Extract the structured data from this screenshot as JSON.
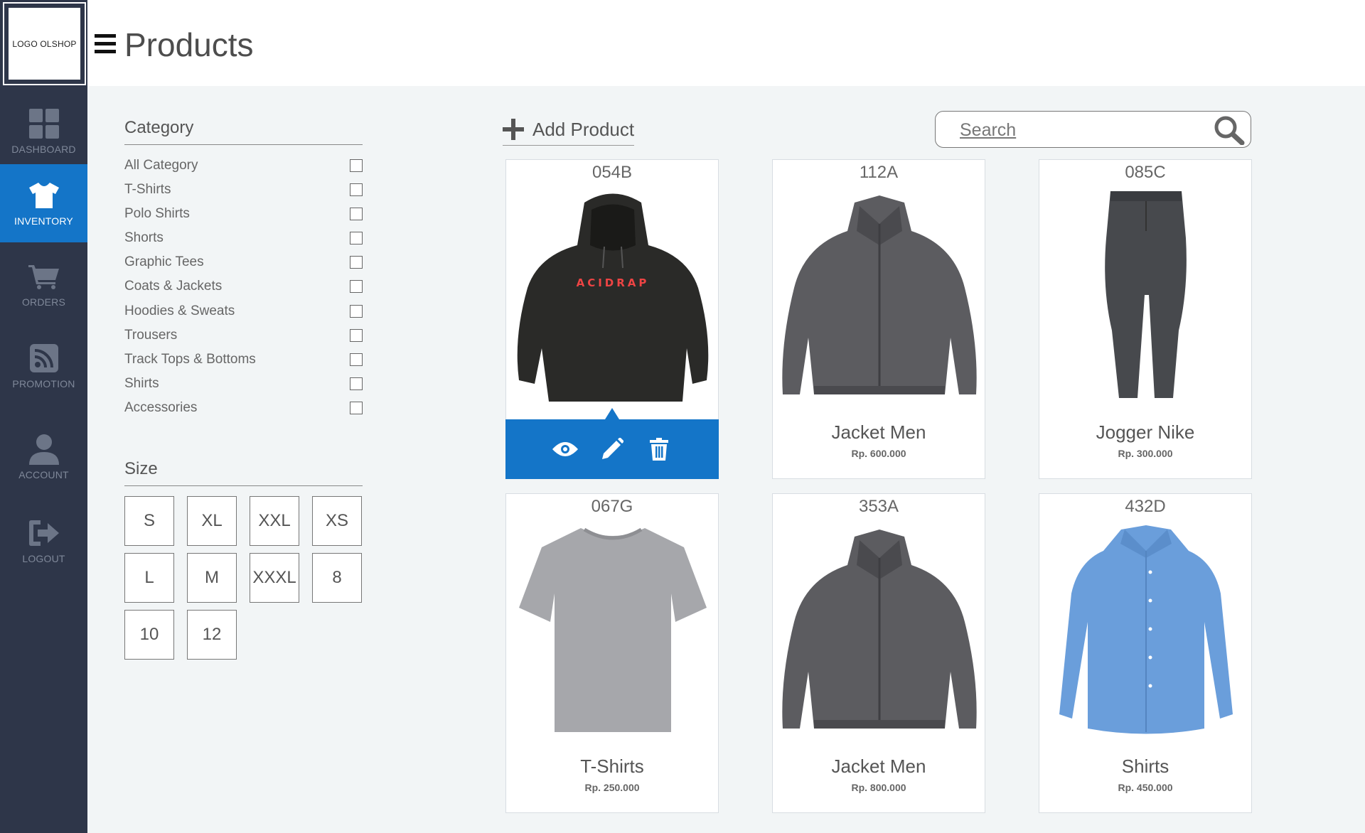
{
  "logo": {
    "text": "LOGO OLSHOP"
  },
  "header": {
    "title": "Products",
    "menu_icon": "hamburger-icon"
  },
  "sidebar": {
    "items": [
      {
        "label": "DASHBOARD",
        "icon": "grid-icon",
        "active": false
      },
      {
        "label": "INVENTORY",
        "icon": "tshirt-icon",
        "active": true
      },
      {
        "label": "ORDERS",
        "icon": "cart-icon",
        "active": false
      },
      {
        "label": "PROMOTION",
        "icon": "rss-icon",
        "active": false
      },
      {
        "label": "ACCOUNT",
        "icon": "user-icon",
        "active": false
      },
      {
        "label": "LOGOUT",
        "icon": "logout-icon",
        "active": false
      }
    ]
  },
  "filters": {
    "category_title": "Category",
    "categories": [
      "All Category",
      "T-Shirts",
      "Polo Shirts",
      "Shorts",
      "Graphic Tees",
      "Coats & Jackets",
      "Hoodies & Sweats",
      "Trousers",
      "Track Tops & Bottoms",
      "Shirts",
      "Accessories"
    ],
    "size_title": "Size",
    "sizes": [
      "S",
      "XL",
      "XXL",
      "XS",
      "L",
      "M",
      "XXXL",
      "8",
      "10",
      "12"
    ]
  },
  "toolbar": {
    "add_label": "Add Product",
    "search_placeholder": "Search"
  },
  "products": [
    {
      "code": "054B",
      "name": "",
      "price": "",
      "image": "black-hoodie",
      "hover_actions": [
        "view-icon",
        "edit-icon",
        "delete-icon"
      ]
    },
    {
      "code": "112A",
      "name": "Jacket Men",
      "price": "Rp. 600.000",
      "image": "grey-jacket"
    },
    {
      "code": "085C",
      "name": "Jogger Nike",
      "price": "Rp. 300.000",
      "image": "grey-jogger"
    },
    {
      "code": "067G",
      "name": "T-Shirts",
      "price": "Rp. 250.000",
      "image": "grey-tshirt"
    },
    {
      "code": "353A",
      "name": "Jacket Men",
      "price": "Rp. 800.000",
      "image": "grey-jacket"
    },
    {
      "code": "432D",
      "name": "Shirts",
      "price": "Rp. 450.000",
      "image": "blue-shirt"
    }
  ],
  "colors": {
    "sidebar": "#2e3649",
    "accent": "#1475c8",
    "background": "#f2f5f6"
  }
}
